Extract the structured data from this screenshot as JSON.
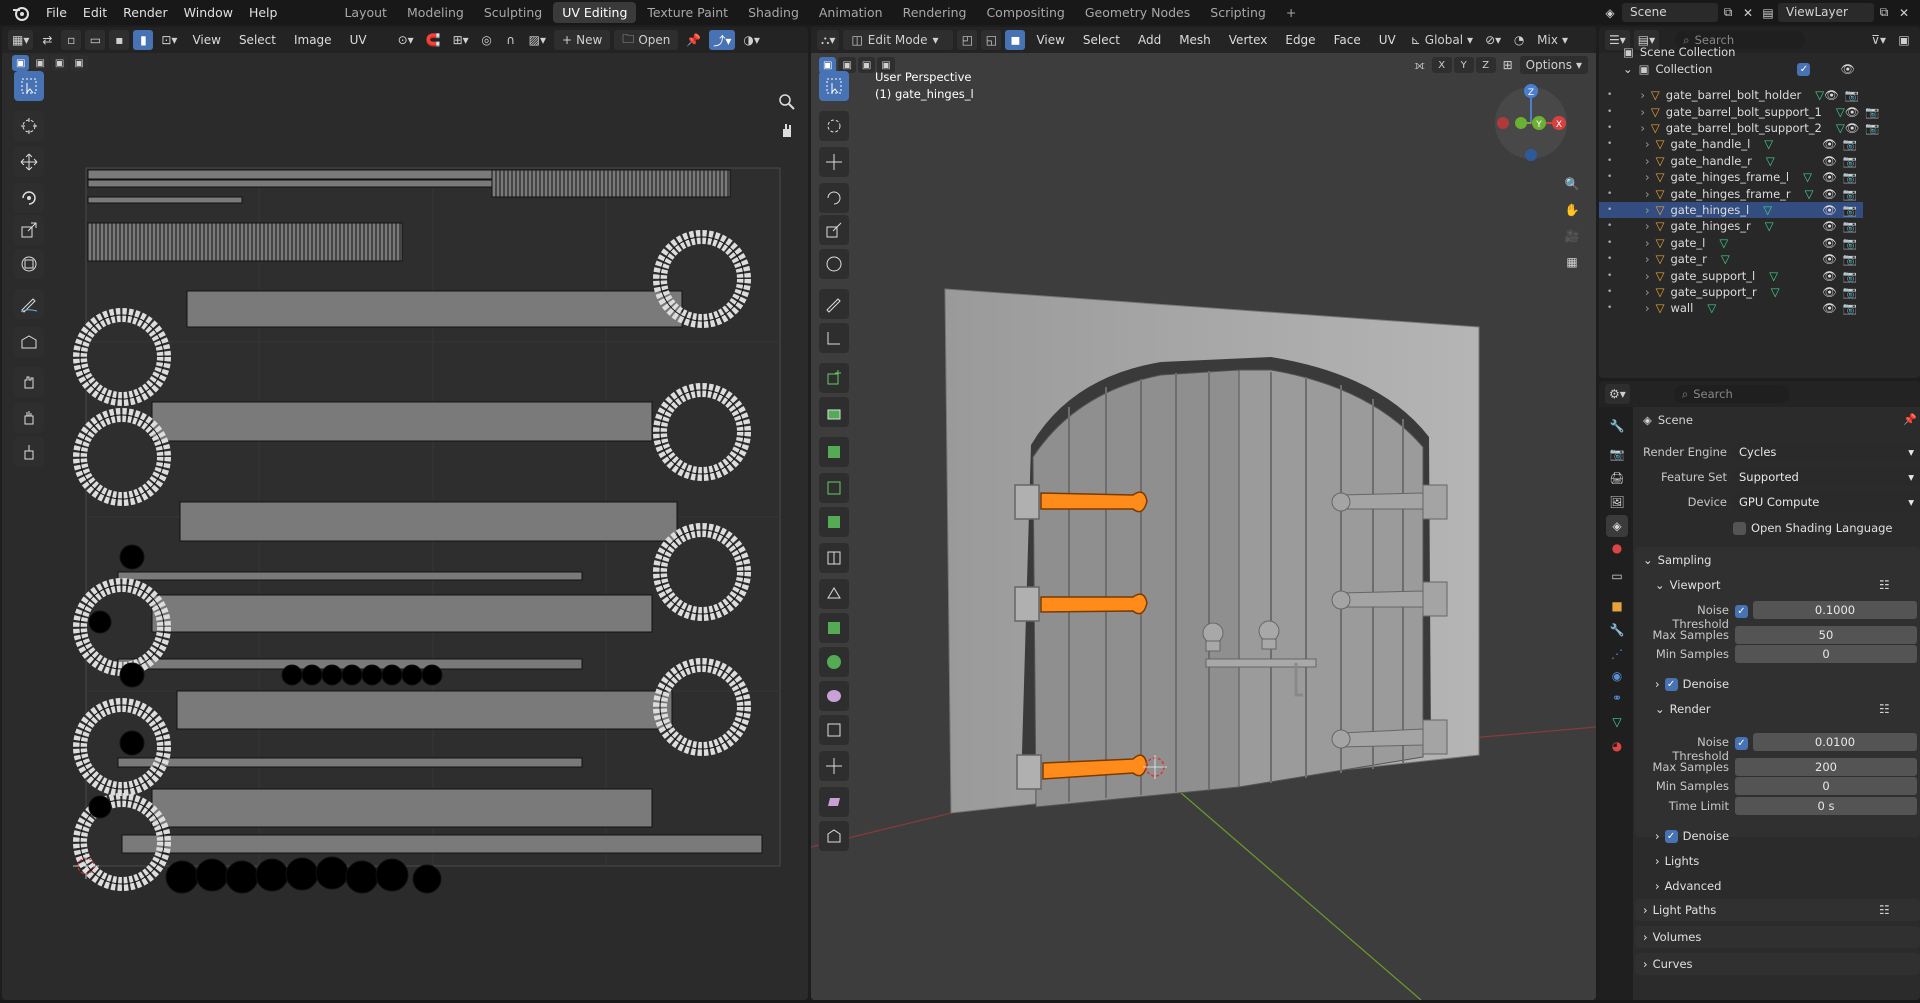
{
  "top_menu": [
    "File",
    "Edit",
    "Render",
    "Window",
    "Help"
  ],
  "workspaces": [
    "Layout",
    "Modeling",
    "Sculpting",
    "UV Editing",
    "Texture Paint",
    "Shading",
    "Animation",
    "Rendering",
    "Compositing",
    "Geometry Nodes",
    "Scripting"
  ],
  "active_workspace": "UV Editing",
  "scene_name": "Scene",
  "view_layer": "ViewLayer",
  "uv_editor": {
    "menus": [
      "View",
      "Select",
      "Image",
      "UV"
    ],
    "new_label": "New",
    "open_label": "Open"
  },
  "viewport": {
    "mode": "Edit Mode",
    "menus": [
      "View",
      "Select",
      "Add",
      "Mesh",
      "Vertex",
      "Edge",
      "Face",
      "UV"
    ],
    "orientation": "Global",
    "shading_mix": "Mix",
    "options_label": "Options",
    "axis_labels": [
      "X",
      "Y",
      "Z"
    ],
    "info_line1": "User Perspective",
    "info_line2": "(1) gate_hinges_l"
  },
  "outliner": {
    "search_placeholder": "Search",
    "scene_collection": "Scene Collection",
    "collection": "Collection",
    "items": [
      "gate_barrel_bolt_holder",
      "gate_barrel_bolt_support_1",
      "gate_barrel_bolt_support_2",
      "gate_handle_l",
      "gate_handle_r",
      "gate_hinges_frame_l",
      "gate_hinges_frame_r",
      "gate_hinges_l",
      "gate_hinges_r",
      "gate_l",
      "gate_r",
      "gate_support_l",
      "gate_support_r",
      "wall"
    ],
    "selected_index": 7
  },
  "properties": {
    "search_placeholder": "Search",
    "context_title": "Scene",
    "render_engine_label": "Render Engine",
    "render_engine": "Cycles",
    "feature_set_label": "Feature Set",
    "feature_set": "Supported",
    "device_label": "Device",
    "device": "GPU Compute",
    "osl_label": "Open Shading Language",
    "sampling": "Sampling",
    "viewport_panel": "Viewport",
    "noise_threshold_label": "Noise Threshold",
    "viewport_noise_threshold": "0.1000",
    "max_samples_label": "Max Samples",
    "viewport_max_samples": "50",
    "min_samples_label": "Min Samples",
    "viewport_min_samples": "0",
    "denoise_label": "Denoise",
    "render_panel": "Render",
    "render_noise_threshold": "0.0100",
    "render_max_samples": "200",
    "render_min_samples": "0",
    "time_limit_label": "Time Limit",
    "time_limit": "0 s",
    "lights": "Lights",
    "advanced": "Advanced",
    "light_paths": "Light Paths",
    "volumes": "Volumes",
    "curves": "Curves"
  },
  "colors": {
    "accent": "#4772b3",
    "selected_orange": "#ff8c1a",
    "mesh_icon": "#e8a43a",
    "data_icon": "#3fd48a"
  }
}
